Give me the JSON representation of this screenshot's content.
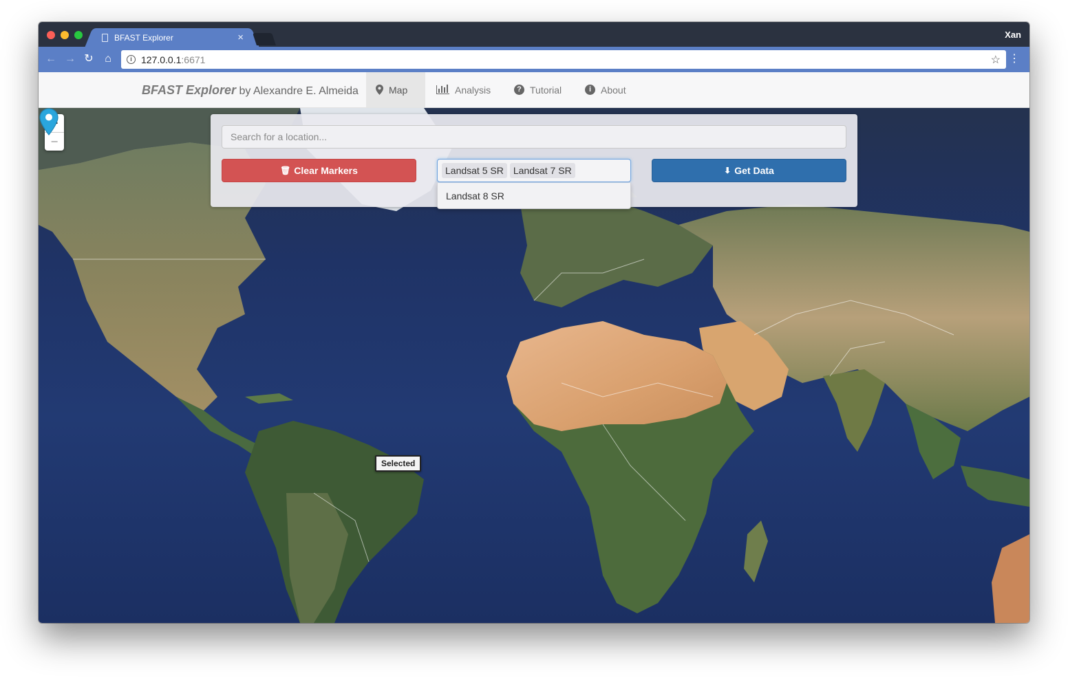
{
  "browser": {
    "tab_title": "BFAST Explorer",
    "tab_close": "×",
    "profile_name": "Xan",
    "url_host": "127.0.0.1",
    "url_port": ":6671"
  },
  "navbar": {
    "brand_name": "BFAST Explorer",
    "brand_by": " by Alexandre E. Almeida",
    "items": [
      {
        "label": "Map",
        "icon": "map-marker-icon",
        "active": true
      },
      {
        "label": "Analysis",
        "icon": "bar-chart-icon",
        "active": false
      },
      {
        "label": "Tutorial",
        "icon": "question-circle-icon",
        "active": false
      },
      {
        "label": "About",
        "icon": "info-circle-icon",
        "active": false
      }
    ]
  },
  "map": {
    "zoom_in": "+",
    "zoom_out": "−",
    "search_placeholder": "Search for a location...",
    "clear_markers_label": "Clear Markers",
    "get_data_label": "Get Data",
    "selected_sensors": [
      "Landsat 5 SR",
      "Landsat 7 SR"
    ],
    "dropdown_options": [
      "Landsat 8 SR"
    ],
    "marker_tooltip": "Selected",
    "colors": {
      "ocean": "#223a73",
      "clear_button": "#d35353",
      "get_data_button": "#2f6fad",
      "marker": "#2aa6dd"
    }
  }
}
